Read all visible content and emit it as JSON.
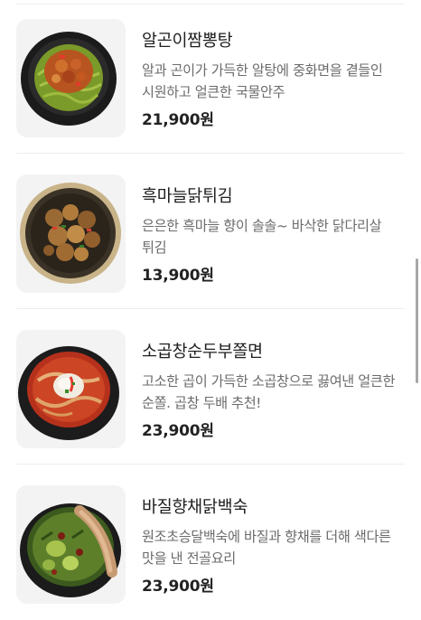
{
  "menu": {
    "items": [
      {
        "name": "알곤이짬뽕탕",
        "description": "알과 곤이가 가득한 알탕에 중화면을 곁들인 시원하고 얼큰한 국물안주",
        "price": "21,900원",
        "image_icon": "seafood-noodle-stew-image"
      },
      {
        "name": "흑마늘닭튀김",
        "description": "은은한 흑마늘 향이 솔솔~ 바삭한 닭다리살 튀김",
        "price": "13,900원",
        "image_icon": "fried-chicken-image"
      },
      {
        "name": "소곱창순두부쫄면",
        "description": "고소한 곱이 가득한 소곱창으로 끓여낸 얼큰한 순쫄. 곱창 두배 추천!",
        "price": "23,900원",
        "image_icon": "tripe-tofu-noodle-image"
      },
      {
        "name": "바질향채닭백숙",
        "description": "원조초승달백숙에 바질과 향채를 더해 색다른 맛을 낸 전골요리",
        "price": "23,900원",
        "image_icon": "basil-chicken-soup-image"
      }
    ]
  },
  "colors": {
    "divider": "#eeeeee",
    "thumb_bg": "#f3f3f3",
    "name": "#1f1f1f",
    "description": "#6b6b6b",
    "price": "#222222",
    "scrollbar": "#a8a8a8"
  }
}
